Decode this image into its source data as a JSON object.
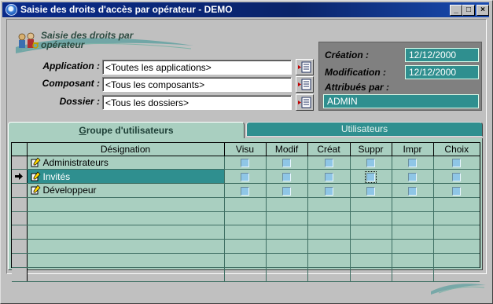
{
  "window": {
    "title": "Saisie des droits d'accès par opérateur - DEMO",
    "controls": [
      "_",
      "□",
      "×"
    ]
  },
  "header": {
    "title": "Saisie des droits par opérateur"
  },
  "form": {
    "application_label": "Application :",
    "application_value": "<Toutes les applications>",
    "composant_label": "Composant :",
    "composant_value": "<Tous les composants>",
    "dossier_label": "Dossier :",
    "dossier_value": "<Tous les dossiers>"
  },
  "info": {
    "creation_label": "Création :",
    "creation_value": "12/12/2000",
    "modification_label": "Modification :",
    "modification_value": "12/12/2000",
    "attribues_label": "Attribués par :",
    "attribues_value": "ADMIN"
  },
  "tabs": [
    {
      "label": "Groupe d'utilisateurs",
      "active": true
    },
    {
      "label": "Utilisateurs",
      "active": false
    }
  ],
  "grid": {
    "columns": [
      "Désignation",
      "Visu",
      "Modif",
      "Créat",
      "Suppr",
      "Impr",
      "Choix"
    ],
    "rows": [
      {
        "designation": "Administrateurs",
        "selected": false
      },
      {
        "designation": "Invités",
        "selected": true
      },
      {
        "designation": "Développeur",
        "selected": false
      }
    ],
    "empty_rows": 6
  },
  "colors": {
    "teal": "#2f8f8f",
    "light_teal": "#a9cfc0",
    "title_bar": "#0a246a"
  }
}
